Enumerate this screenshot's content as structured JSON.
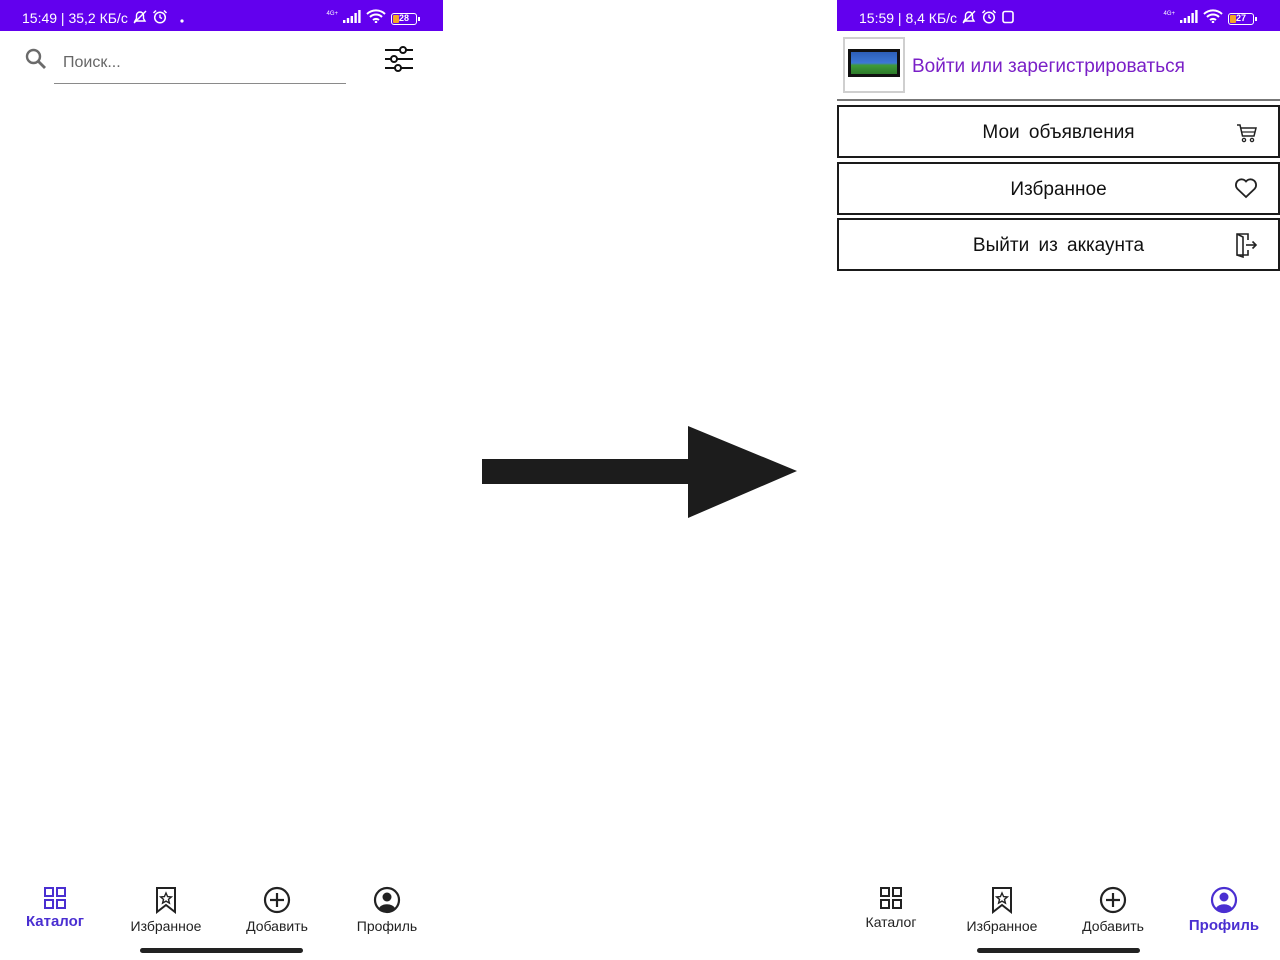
{
  "left_screen": {
    "status": {
      "text": "15:49 | 35,2 КБ/с",
      "network": "4G+",
      "battery": "28",
      "battery_level": 0.28
    },
    "search": {
      "placeholder": "Поиск...",
      "search_icon": "search-icon",
      "filter_icon": "sliders-icon"
    },
    "nav": {
      "active": "catalog",
      "items": [
        {
          "id": "catalog",
          "label": "Каталог",
          "icon": "grid-icon"
        },
        {
          "id": "favorites",
          "label": "Избранное",
          "icon": "bookmark-star-icon"
        },
        {
          "id": "add",
          "label": "Добавить",
          "icon": "plus-circle-icon"
        },
        {
          "id": "profile",
          "label": "Профиль",
          "icon": "account-icon"
        }
      ]
    }
  },
  "right_screen": {
    "status": {
      "text": "15:59 | 8,4 КБ/с",
      "network": "4G+",
      "battery": "27",
      "battery_level": 0.27
    },
    "profile": {
      "login_text": "Войти или зарегистрироваться"
    },
    "menu": [
      {
        "label": "Мои объявления",
        "icon": "cart-icon"
      },
      {
        "label": "Избранное",
        "icon": "heart-icon"
      },
      {
        "label": "Выйти из аккаунта",
        "icon": "logout-door-icon"
      }
    ],
    "nav": {
      "active": "profile",
      "items": [
        {
          "id": "catalog",
          "label": "Каталог",
          "icon": "grid-icon"
        },
        {
          "id": "favorites",
          "label": "Избранное",
          "icon": "bookmark-star-icon"
        },
        {
          "id": "add",
          "label": "Добавить",
          "icon": "plus-circle-icon"
        },
        {
          "id": "profile",
          "label": "Профиль",
          "icon": "account-icon"
        }
      ]
    }
  },
  "colors": {
    "status_bar": "#6200ee",
    "active_nav": "#4a2fd1",
    "login_link": "#7a1fc7",
    "text": "#1a1a1a"
  }
}
